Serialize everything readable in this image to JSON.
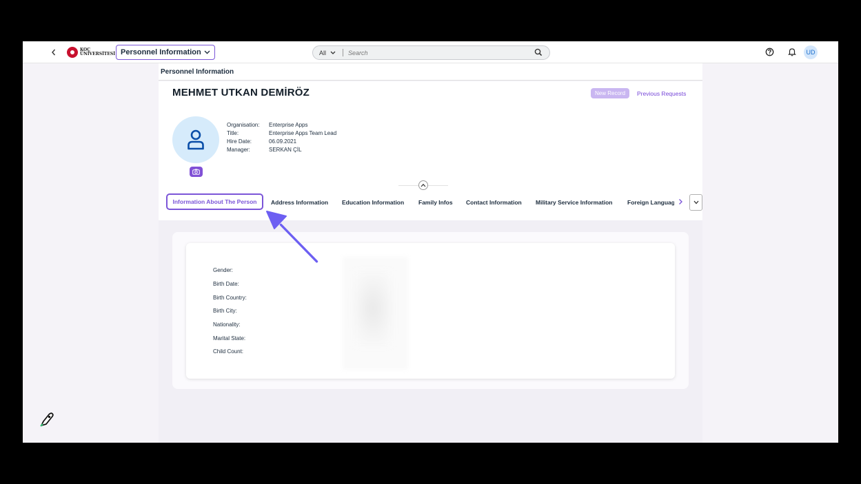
{
  "shell": {
    "logo_text_line1": "KOÇ",
    "logo_text_line2": "ÜNİVERSİTESİ",
    "app_menu_label": "Personnel Information",
    "search_scope": "All",
    "search_placeholder": "Search",
    "avatar_initials": "UD"
  },
  "page": {
    "title": "Personnel Information",
    "person_name": "MEHMET UTKAN DEMİRÖZ",
    "actions": {
      "new_record": "New Record",
      "previous_requests": "Previous Requests"
    },
    "attributes": [
      {
        "label": "Organisation:",
        "value": "Enterprise Apps"
      },
      {
        "label": "Title:",
        "value": "Enterprise Apps Team Lead"
      },
      {
        "label": "Hire Date:",
        "value": "06.09.2021"
      },
      {
        "label": "Manager:",
        "value": "SERKAN ÇİL"
      }
    ]
  },
  "tabs": [
    {
      "label": "Information About The Person",
      "selected": true
    },
    {
      "label": "Address Information"
    },
    {
      "label": "Education Information"
    },
    {
      "label": "Family Infos"
    },
    {
      "label": "Contact Information"
    },
    {
      "label": "Military Service Information"
    },
    {
      "label": "Foreign Languag"
    }
  ],
  "fields": [
    {
      "label": "Gender:"
    },
    {
      "label": "Birth Date:"
    },
    {
      "label": "Birth Country:"
    },
    {
      "label": "Birth City:"
    },
    {
      "label": "Nationality:"
    },
    {
      "label": "Marital State:"
    },
    {
      "label": "Child Count:"
    }
  ],
  "colors": {
    "accent": "#7b55d8",
    "arrow": "#6d5ff2"
  }
}
